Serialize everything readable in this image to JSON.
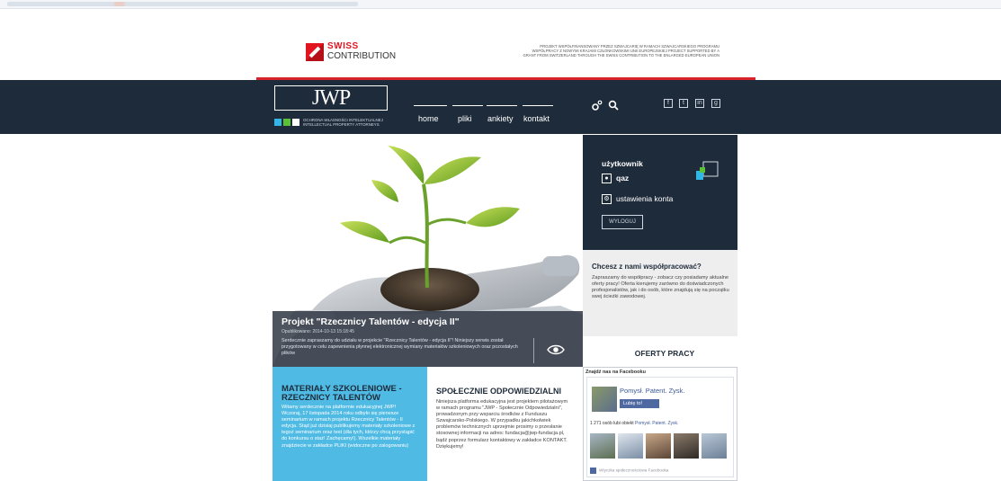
{
  "header": {
    "swiss_word": "SWISS",
    "swiss_contribution": "CONTRIBUTION",
    "project_note": "PROJEKT WSPÓŁFINANSOWANY PRZEZ SZWAJCARIĘ W RAMACH SZWAJCARSKIEGO PROGRAMU WSPÓŁPRACY Z NOWYMI KRAJAMI CZŁONKOWSKIMI UNII EUROPEJSKIEJ PROJECT SUPPORTED BY A GRANT FROM SWITZERLAND THROUGH THE SWISS CONTRIBUTION TO THE ENLARGED EUROPEAN UNION"
  },
  "nav": {
    "logo": "JWP",
    "logo_sub_1": "OCHRONA WŁASNOŚCI INTELEKTUALNEJ",
    "logo_sub_2": "INTELLECTUAL PROPERTY ATTORNEYS",
    "items": [
      {
        "label": "home"
      },
      {
        "label": "pliki"
      },
      {
        "label": "ankiety"
      },
      {
        "label": "kontakt"
      }
    ],
    "icons": [
      "settings-icon",
      "search-icon"
    ],
    "social": [
      "facebook-icon",
      "twitter-icon",
      "linkedin-icon",
      "google-plus-icon"
    ]
  },
  "hero": {
    "title": "Projekt \"Rzecznicy Talentów - edycja II\"",
    "date": "Opublikowano: 2014-10-13 15:18:45",
    "description": "Serdecznie zapraszamy do udziału w projekcie \"Rzecznicy Talentów - edycja II\"! Niniejszy serwis został przygotowany w celu zapewnienia płynnej elektronicznej wymiany materiałów szkoleniowych oraz pozostałych plików"
  },
  "user_panel": {
    "title": "użytkownik",
    "username": "qaz",
    "settings_label": "ustawienia konta",
    "logout_label": "WYLOGUJ"
  },
  "cooperation": {
    "title": "Chcesz z nami współpracować?",
    "text": "Zapraszamy do współpracy - zobacz czy posiadamy aktualne oferty pracy! Oferta kierujemy zarówno do doświadczonych profesjonalistów, jak i do osób, które znajdują się na początku swej ścieżki zawodowej."
  },
  "offers": {
    "label": "OFERTY PRACY"
  },
  "col_blue": {
    "title": "MATERIAŁY SZKOLENIOWE - RZECZNICY TALENTÓW",
    "text": "Witamy serdecznie na platformie edukacyjnej JWP! Wczoraj, 17 listopada 2014 roku odbyło się pierwsze seminarium w ramach projektu Rzecznicy Talentów - II edycja. Stąd już dzisiaj publikujemy materiały szkoleniowe z tegoż seminarium oraz test (dla tych, którzy chcą przystąpić do konkursu o staż! Zachęcamy!). Wszelkie materiały znajdziecie w zakładce PLIKI (widoczne po zalogowaniu)"
  },
  "col_white": {
    "title": "SPOŁECZNIE ODPOWIEDZIALNI",
    "text": "Niniejsza platforma edukacyjna jest projektem pilotażowym w ramach programu \"JWP - Społecznie Odpowiedzialni\", prowadzonym przy wsparciu środków z Funduszu Szwajcarsko-Polskiego. W przypadku jakichkolwiek problemów technicznych uprzejmie prosimy o przesłanie stosownej informacji na adres: fundacja@jwp-fundacja.pl, bądź poprzez formularz kontaktowy w zakładce KONTAKT. Dziękujemy!"
  },
  "facebook": {
    "header": "Znajdź nas na Facebooku",
    "page_name": "Pomysł. Patent. Zysk.",
    "like_label": "Lubię to!",
    "count_text": "1 271 osób lubi obiekt",
    "count_link": "Pomysł. Patent. Zysk.",
    "plugin_text": "Wtyczka społecznościowa Facebooka"
  },
  "colors": {
    "navy": "#1e2b3a",
    "swiss_red": "#e1141f",
    "accent_blue": "#4fbbe4",
    "logo_green": "#5bc236",
    "logo_cyan": "#31b7e5",
    "fb_blue": "#3b5998"
  }
}
